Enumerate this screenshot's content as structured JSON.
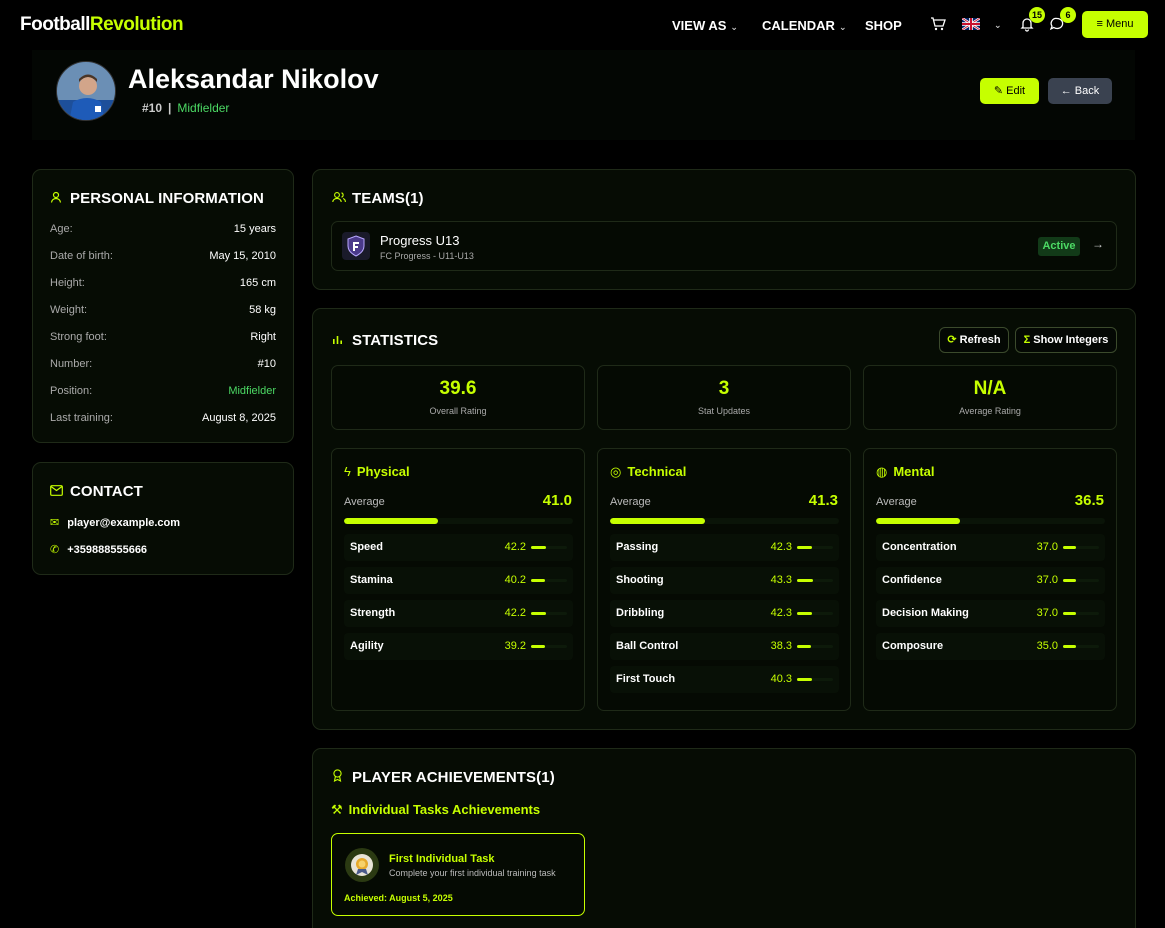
{
  "nav": {
    "logo_a": "Football",
    "logo_b": "Revolution",
    "links": [
      "VIEW AS",
      "CALENDAR",
      "SHOP"
    ],
    "notifications_count": "15",
    "messages_count": "6",
    "menu_label": "Menu"
  },
  "player": {
    "name": "Aleksandar Nikolov",
    "number": "#10",
    "separator": "|",
    "position": "Midfielder",
    "edit_label": "Edit",
    "back_label": "Back"
  },
  "personal": {
    "title": "PERSONAL INFORMATION",
    "rows": [
      {
        "k": "Age:",
        "v": "15 years"
      },
      {
        "k": "Date of birth:",
        "v": "May 15, 2010"
      },
      {
        "k": "Height:",
        "v": "165 cm"
      },
      {
        "k": "Weight:",
        "v": "58 kg"
      },
      {
        "k": "Strong foot:",
        "v": "Right"
      },
      {
        "k": "Number:",
        "v": "#10"
      },
      {
        "k": "Position:",
        "v": "Midfielder"
      },
      {
        "k": "Last training:",
        "v": "August 8, 2025"
      }
    ]
  },
  "contact": {
    "title": "CONTACT",
    "email": "player@example.com",
    "phone": "+359888555666"
  },
  "teams": {
    "title": "TEAMS(1)",
    "items": [
      {
        "name": "Progress U13",
        "sub": "FC Progress - U11-U13",
        "status": "Active"
      }
    ]
  },
  "statistics": {
    "title": "STATISTICS",
    "refresh_label": "Refresh",
    "integers_label": "Show Integers",
    "average_label": "Average",
    "summary": [
      {
        "value": "39.6",
        "label": "Overall Rating"
      },
      {
        "value": "3",
        "label": "Stat Updates"
      },
      {
        "value": "N/A",
        "label": "Average Rating"
      }
    ],
    "categories": [
      {
        "name": "Physical",
        "average": "41.0",
        "average_pct": 41,
        "attributes": [
          {
            "name": "Speed",
            "value": "42.2",
            "pct": 42.2
          },
          {
            "name": "Stamina",
            "value": "40.2",
            "pct": 40.2
          },
          {
            "name": "Strength",
            "value": "42.2",
            "pct": 42.2
          },
          {
            "name": "Agility",
            "value": "39.2",
            "pct": 39.2
          }
        ]
      },
      {
        "name": "Technical",
        "average": "41.3",
        "average_pct": 41.3,
        "attributes": [
          {
            "name": "Passing",
            "value": "42.3",
            "pct": 42.3
          },
          {
            "name": "Shooting",
            "value": "43.3",
            "pct": 43.3
          },
          {
            "name": "Dribbling",
            "value": "42.3",
            "pct": 42.3
          },
          {
            "name": "Ball Control",
            "value": "38.3",
            "pct": 38.3
          },
          {
            "name": "First Touch",
            "value": "40.3",
            "pct": 40.3
          }
        ]
      },
      {
        "name": "Mental",
        "average": "36.5",
        "average_pct": 36.5,
        "attributes": [
          {
            "name": "Concentration",
            "value": "37.0",
            "pct": 37
          },
          {
            "name": "Confidence",
            "value": "37.0",
            "pct": 37
          },
          {
            "name": "Decision Making",
            "value": "37.0",
            "pct": 37
          },
          {
            "name": "Composure",
            "value": "35.0",
            "pct": 35
          }
        ]
      }
    ]
  },
  "achievements": {
    "title": "PLAYER ACHIEVEMENTS(1)",
    "section_title": "Individual Tasks Achievements",
    "items": [
      {
        "title": "First Individual Task",
        "desc": "Complete your first individual training task",
        "date": "Achieved: August 5, 2025"
      }
    ]
  },
  "colors": {
    "accent": "#c6ff00",
    "positive": "#4cd964",
    "background": "#000000",
    "card": "#060c04"
  }
}
